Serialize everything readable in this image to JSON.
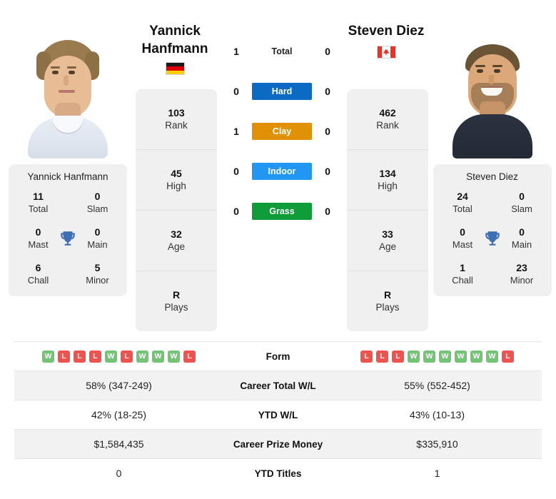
{
  "players": {
    "left": {
      "name_line1": "Yannick",
      "name_line2": "Hanfmann",
      "full_name": "Yannick Hanfmann",
      "country": "Germany",
      "flag_icon": "flag-germany-icon",
      "info": [
        {
          "value": "103",
          "label": "Rank"
        },
        {
          "value": "45",
          "label": "High"
        },
        {
          "value": "32",
          "label": "Age"
        },
        {
          "value": "R",
          "label": "Plays"
        }
      ],
      "titles": [
        {
          "value": "11",
          "label": "Total"
        },
        {
          "value": "0",
          "label": "Slam"
        },
        {
          "value": "0",
          "label": "Mast"
        },
        {
          "value": "0",
          "label": "Main"
        },
        {
          "value": "6",
          "label": "Chall"
        },
        {
          "value": "5",
          "label": "Minor"
        }
      ],
      "form": [
        "W",
        "L",
        "L",
        "L",
        "W",
        "L",
        "W",
        "W",
        "W",
        "L"
      ],
      "career_total_wl": "58% (347-249)",
      "ytd_wl": "42% (18-25)",
      "career_prize_money": "$1,584,435",
      "ytd_titles": "0"
    },
    "right": {
      "name_line1": "Steven Diez",
      "name_line2": "",
      "full_name": "Steven Diez",
      "country": "Canada",
      "flag_icon": "flag-canada-icon",
      "info": [
        {
          "value": "462",
          "label": "Rank"
        },
        {
          "value": "134",
          "label": "High"
        },
        {
          "value": "33",
          "label": "Age"
        },
        {
          "value": "R",
          "label": "Plays"
        }
      ],
      "titles": [
        {
          "value": "24",
          "label": "Total"
        },
        {
          "value": "0",
          "label": "Slam"
        },
        {
          "value": "0",
          "label": "Mast"
        },
        {
          "value": "0",
          "label": "Main"
        },
        {
          "value": "1",
          "label": "Chall"
        },
        {
          "value": "23",
          "label": "Minor"
        }
      ],
      "form": [
        "L",
        "L",
        "L",
        "W",
        "W",
        "W",
        "W",
        "W",
        "W",
        "L"
      ],
      "career_total_wl": "55% (552-452)",
      "ytd_wl": "43% (10-13)",
      "career_prize_money": "$335,910",
      "ytd_titles": "1"
    }
  },
  "head_to_head": [
    {
      "label": "Total",
      "left": "1",
      "right": "0",
      "color": ""
    },
    {
      "label": "Hard",
      "left": "0",
      "right": "0",
      "color": "#0b6bc4"
    },
    {
      "label": "Clay",
      "left": "1",
      "right": "0",
      "color": "#e09105"
    },
    {
      "label": "Indoor",
      "left": "0",
      "right": "0",
      "color": "#2196f3"
    },
    {
      "label": "Grass",
      "left": "0",
      "right": "0",
      "color": "#0f9d3a"
    }
  ],
  "stats_rows": [
    {
      "label": "Form",
      "type": "form"
    },
    {
      "label": "Career Total W/L",
      "type": "text",
      "key": "career_total_wl"
    },
    {
      "label": "YTD W/L",
      "type": "text",
      "key": "ytd_wl"
    },
    {
      "label": "Career Prize Money",
      "type": "text",
      "key": "career_prize_money"
    },
    {
      "label": "YTD Titles",
      "type": "text",
      "key": "ytd_titles"
    }
  ],
  "colors": {
    "hard": "#0b6bc4",
    "clay": "#e09105",
    "indoor": "#2196f3",
    "grass": "#0f9d3a",
    "win_badge": "#74c476",
    "loss_badge": "#ef5350",
    "trophy": "#3d6fb4",
    "card_bg": "#f0f0f0"
  }
}
